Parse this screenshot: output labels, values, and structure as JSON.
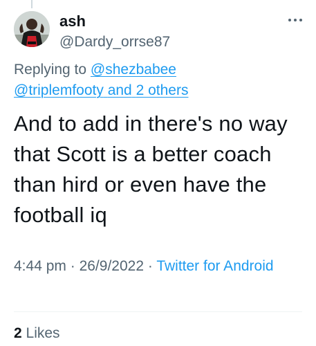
{
  "tweet": {
    "author": {
      "display_name": "ash",
      "handle": "@Dardy_orrse87",
      "avatar_icon": "user-avatar-icon"
    },
    "more_icon": "more-horizontal-icon",
    "replying": {
      "prefix": "Replying to",
      "mention_1": "@shezbabee",
      "mention_2": "@triplemfooty",
      "joiner": "and",
      "others": "2 others"
    },
    "text": "And to add in there's no way that Scott is a better coach than hird or even have the football iq",
    "time": "4:44 pm",
    "separator": "·",
    "date": "26/9/2022",
    "source": "Twitter for Android",
    "likes_count": "2",
    "likes_label": "Likes"
  },
  "colors": {
    "text": "#0f1419",
    "secondary": "#536471",
    "link": "#1d9bf0",
    "divider": "#eff3f4"
  }
}
